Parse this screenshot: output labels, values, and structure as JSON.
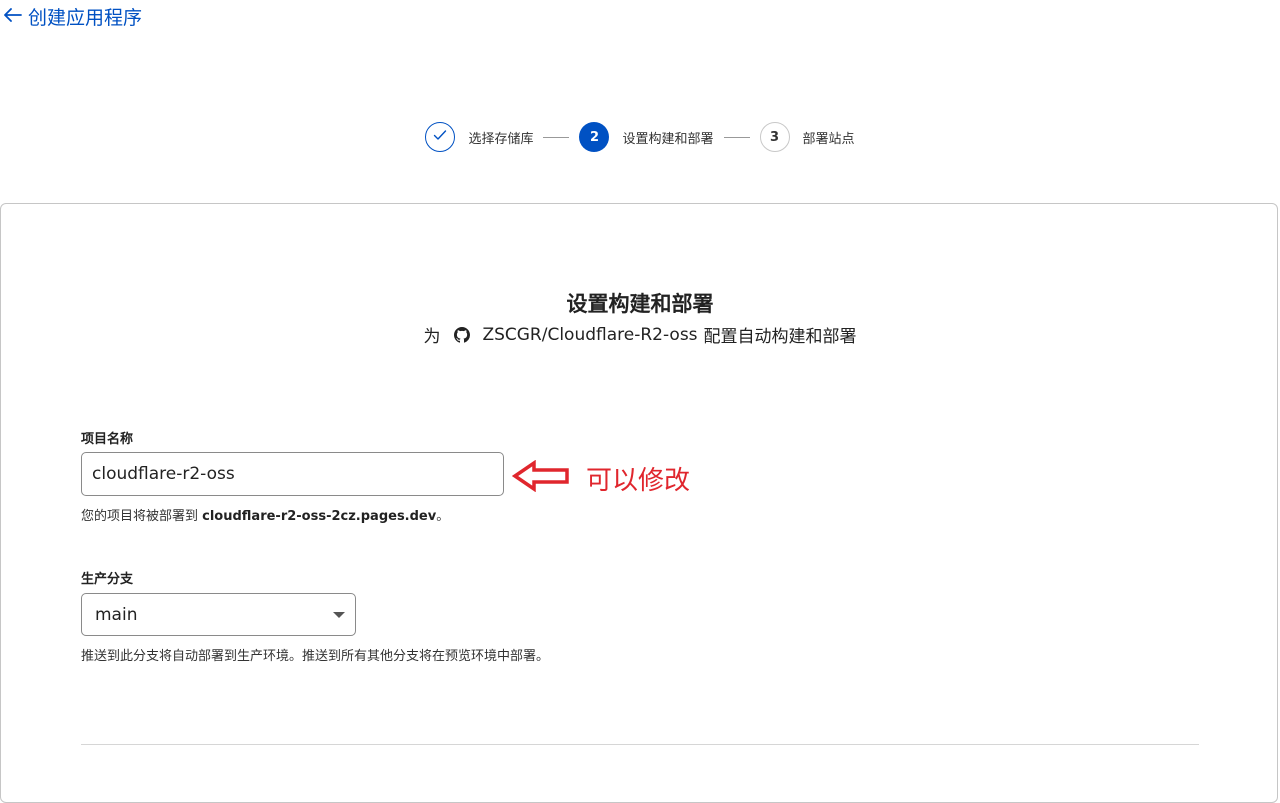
{
  "header": {
    "back_label": "创建应用程序"
  },
  "stepper": {
    "steps": [
      {
        "number": "",
        "label": "选择存储库",
        "state": "done"
      },
      {
        "number": "2",
        "label": "设置构建和部署",
        "state": "active"
      },
      {
        "number": "3",
        "label": "部署站点",
        "state": "pending"
      }
    ]
  },
  "card": {
    "title": "设置构建和部署",
    "subtitle_prefix": "为",
    "repo": "ZSCGR/Cloudflare-R2-oss",
    "subtitle_suffix": "配置自动构建和部署"
  },
  "project_name": {
    "label": "项目名称",
    "value": "cloudflare-r2-oss",
    "help_prefix": "您的项目将被部署到 ",
    "help_domain": "cloudflare-r2-oss-2cz.pages.dev",
    "help_suffix": "。"
  },
  "annotation": {
    "text": "可以修改",
    "color": "#e0262d"
  },
  "production_branch": {
    "label": "生产分支",
    "selected": "main",
    "help": "推送到此分支将自动部署到生产环境。推送到所有其他分支将在预览环境中部署。"
  },
  "colors": {
    "accent": "#0051c3",
    "annotation": "#e0262d"
  }
}
